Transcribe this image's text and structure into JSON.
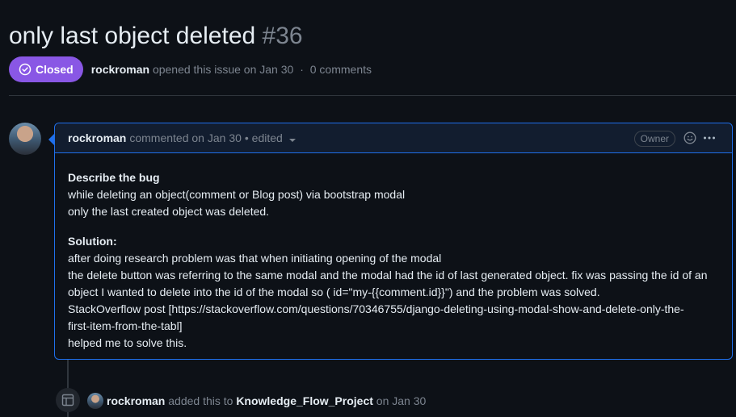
{
  "issue": {
    "title": "only last object deleted",
    "number": "#36",
    "state_label": "Closed",
    "author": "rockroman",
    "meta_text": "opened this issue on Jan 30",
    "comments_count": "0 comments",
    "state_color": "#8957e5"
  },
  "comment": {
    "author": "rockroman",
    "action_text": "commented on Jan 30",
    "edited_text": "• edited",
    "badge": "Owner",
    "icons": {
      "reaction": "smiley-icon",
      "more": "kebab-horizontal-icon",
      "caret": "triangle-down-icon"
    },
    "body": {
      "heading_1": "Describe the bug",
      "lines_1": [
        "while deleting an object(comment or Blog post) via bootstrap modal",
        "only the last created object was deleted."
      ],
      "heading_2": "Solution:",
      "lines_2": [
        "after doing research problem was that when initiating opening of the modal",
        "the delete button was referring to the same modal and the modal had the id of last generated object. fix was passing the id of an",
        "object I wanted to delete into the id of the modal so ( id=\"my-{{comment.id}}\") and the problem was solved.",
        "StackOverflow post [https://stackoverflow.com/questions/70346755/django-deleting-using-modal-show-and-delete-only-the-",
        "first-item-from-the-tabl]",
        "helped me to solve this."
      ]
    }
  },
  "timeline_event": {
    "actor": "rockroman",
    "action": "added this to",
    "project": "Knowledge_Flow_Project",
    "date_text": "on Jan 30",
    "icon": "project-icon"
  }
}
